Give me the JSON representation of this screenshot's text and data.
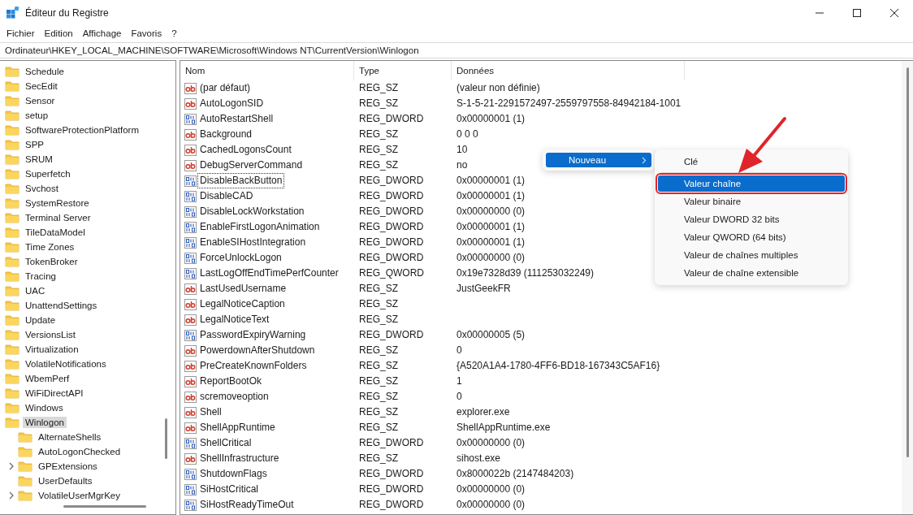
{
  "window": {
    "title": "Éditeur du Registre"
  },
  "menu_bar": [
    "Fichier",
    "Edition",
    "Affichage",
    "Favoris",
    "?"
  ],
  "address_bar": {
    "path": "Ordinateur\\HKEY_LOCAL_MACHINE\\SOFTWARE\\Microsoft\\Windows NT\\CurrentVersion\\Winlogon"
  },
  "tree": {
    "items": [
      {
        "label": "Schedule",
        "selected": false
      },
      {
        "label": "SecEdit",
        "selected": false
      },
      {
        "label": "Sensor",
        "selected": false
      },
      {
        "label": "setup",
        "selected": false
      },
      {
        "label": "SoftwareProtectionPlatform",
        "selected": false
      },
      {
        "label": "SPP",
        "selected": false
      },
      {
        "label": "SRUM",
        "selected": false
      },
      {
        "label": "Superfetch",
        "selected": false
      },
      {
        "label": "Svchost",
        "selected": false
      },
      {
        "label": "SystemRestore",
        "selected": false
      },
      {
        "label": "Terminal Server",
        "selected": false
      },
      {
        "label": "TileDataModel",
        "selected": false
      },
      {
        "label": "Time Zones",
        "selected": false
      },
      {
        "label": "TokenBroker",
        "selected": false
      },
      {
        "label": "Tracing",
        "selected": false
      },
      {
        "label": "UAC",
        "selected": false
      },
      {
        "label": "UnattendSettings",
        "selected": false
      },
      {
        "label": "Update",
        "selected": false
      },
      {
        "label": "VersionsList",
        "selected": false
      },
      {
        "label": "Virtualization",
        "selected": false
      },
      {
        "label": "VolatileNotifications",
        "selected": false
      },
      {
        "label": "WbemPerf",
        "selected": false
      },
      {
        "label": "WiFiDirectAPI",
        "selected": false
      },
      {
        "label": "Windows",
        "selected": false
      },
      {
        "label": "Winlogon",
        "selected": true,
        "children": [
          {
            "label": "AlternateShells",
            "selected": false,
            "expandable": false
          },
          {
            "label": "AutoLogonChecked",
            "selected": false,
            "expandable": false
          },
          {
            "label": "GPExtensions",
            "selected": false,
            "expandable": true
          },
          {
            "label": "UserDefaults",
            "selected": false,
            "expandable": false
          },
          {
            "label": "VolatileUserMgrKey",
            "selected": false,
            "expandable": true
          }
        ]
      }
    ]
  },
  "table": {
    "columns": [
      "Nom",
      "Type",
      "Données"
    ],
    "rows": [
      {
        "kind": "string",
        "name": "(par défaut)",
        "type": "REG_SZ",
        "data": "(valeur non définie)",
        "focused": false
      },
      {
        "kind": "string",
        "name": "AutoLogonSID",
        "type": "REG_SZ",
        "data": "S-1-5-21-2291572497-2559797558-84942184-1001",
        "focused": false
      },
      {
        "kind": "binary",
        "name": "AutoRestartShell",
        "type": "REG_DWORD",
        "data": "0x00000001 (1)",
        "focused": false
      },
      {
        "kind": "string",
        "name": "Background",
        "type": "REG_SZ",
        "data": "0 0 0",
        "focused": false
      },
      {
        "kind": "string",
        "name": "CachedLogonsCount",
        "type": "REG_SZ",
        "data": "10",
        "focused": false
      },
      {
        "kind": "string",
        "name": "DebugServerCommand",
        "type": "REG_SZ",
        "data": "no",
        "focused": false
      },
      {
        "kind": "binary",
        "name": "DisableBackButton",
        "type": "REG_DWORD",
        "data": "0x00000001 (1)",
        "focused": true
      },
      {
        "kind": "binary",
        "name": "DisableCAD",
        "type": "REG_DWORD",
        "data": "0x00000001 (1)",
        "focused": false
      },
      {
        "kind": "binary",
        "name": "DisableLockWorkstation",
        "type": "REG_DWORD",
        "data": "0x00000000 (0)",
        "focused": false
      },
      {
        "kind": "binary",
        "name": "EnableFirstLogonAnimation",
        "type": "REG_DWORD",
        "data": "0x00000001 (1)",
        "focused": false
      },
      {
        "kind": "binary",
        "name": "EnableSIHostIntegration",
        "type": "REG_DWORD",
        "data": "0x00000001 (1)",
        "focused": false
      },
      {
        "kind": "binary",
        "name": "ForceUnlockLogon",
        "type": "REG_DWORD",
        "data": "0x00000000 (0)",
        "focused": false
      },
      {
        "kind": "binary",
        "name": "LastLogOffEndTimePerfCounter",
        "type": "REG_QWORD",
        "data": "0x19e7328d39 (111253032249)",
        "focused": false
      },
      {
        "kind": "string",
        "name": "LastUsedUsername",
        "type": "REG_SZ",
        "data": "JustGeekFR",
        "focused": false
      },
      {
        "kind": "string",
        "name": "LegalNoticeCaption",
        "type": "REG_SZ",
        "focused": false
      },
      {
        "kind": "string",
        "name": "LegalNoticeText",
        "type": "REG_SZ",
        "focused": false
      },
      {
        "kind": "binary",
        "name": "PasswordExpiryWarning",
        "type": "REG_DWORD",
        "data": "0x00000005 (5)",
        "focused": false
      },
      {
        "kind": "string",
        "name": "PowerdownAfterShutdown",
        "type": "REG_SZ",
        "data": "0",
        "focused": false
      },
      {
        "kind": "string",
        "name": "PreCreateKnownFolders",
        "type": "REG_SZ",
        "data": "{A520A1A4-1780-4FF6-BD18-167343C5AF16}",
        "focused": false
      },
      {
        "kind": "string",
        "name": "ReportBootOk",
        "type": "REG_SZ",
        "data": "1",
        "focused": false
      },
      {
        "kind": "string",
        "name": "scremoveoption",
        "type": "REG_SZ",
        "data": "0",
        "focused": false
      },
      {
        "kind": "string",
        "name": "Shell",
        "type": "REG_SZ",
        "data": "explorer.exe",
        "focused": false
      },
      {
        "kind": "string",
        "name": "ShellAppRuntime",
        "type": "REG_SZ",
        "data": "ShellAppRuntime.exe",
        "focused": false
      },
      {
        "kind": "binary",
        "name": "ShellCritical",
        "type": "REG_DWORD",
        "data": "0x00000000 (0)",
        "focused": false
      },
      {
        "kind": "string",
        "name": "ShellInfrastructure",
        "type": "REG_SZ",
        "data": "sihost.exe",
        "focused": false
      },
      {
        "kind": "binary",
        "name": "ShutdownFlags",
        "type": "REG_DWORD",
        "data": "0x8000022b (2147484203)",
        "focused": false
      },
      {
        "kind": "binary",
        "name": "SiHostCritical",
        "type": "REG_DWORD",
        "data": "0x00000000 (0)",
        "focused": false
      },
      {
        "kind": "binary",
        "name": "SiHostReadyTimeOut",
        "type": "REG_DWORD",
        "data": "0x00000000 (0)",
        "focused": false
      }
    ]
  },
  "context_menu": {
    "items": [
      {
        "label": "Nouveau",
        "selected": true
      }
    ]
  },
  "submenu": {
    "items": [
      {
        "kind": "item",
        "label": "Clé",
        "selected": false,
        "annotated": false
      },
      {
        "kind": "separator"
      },
      {
        "kind": "item",
        "label": "Valeur chaîne",
        "selected": true,
        "annotated": true
      },
      {
        "kind": "item",
        "label": "Valeur binaire",
        "selected": false,
        "annotated": false
      },
      {
        "kind": "item",
        "label": "Valeur DWORD 32 bits",
        "selected": false,
        "annotated": false
      },
      {
        "kind": "item",
        "label": "Valeur QWORD (64 bits)",
        "selected": false,
        "annotated": false
      },
      {
        "kind": "item",
        "label": "Valeur de chaînes multiples",
        "selected": false,
        "annotated": false
      },
      {
        "kind": "item",
        "label": "Valeur de chaîne extensible",
        "selected": false,
        "annotated": false
      }
    ]
  }
}
